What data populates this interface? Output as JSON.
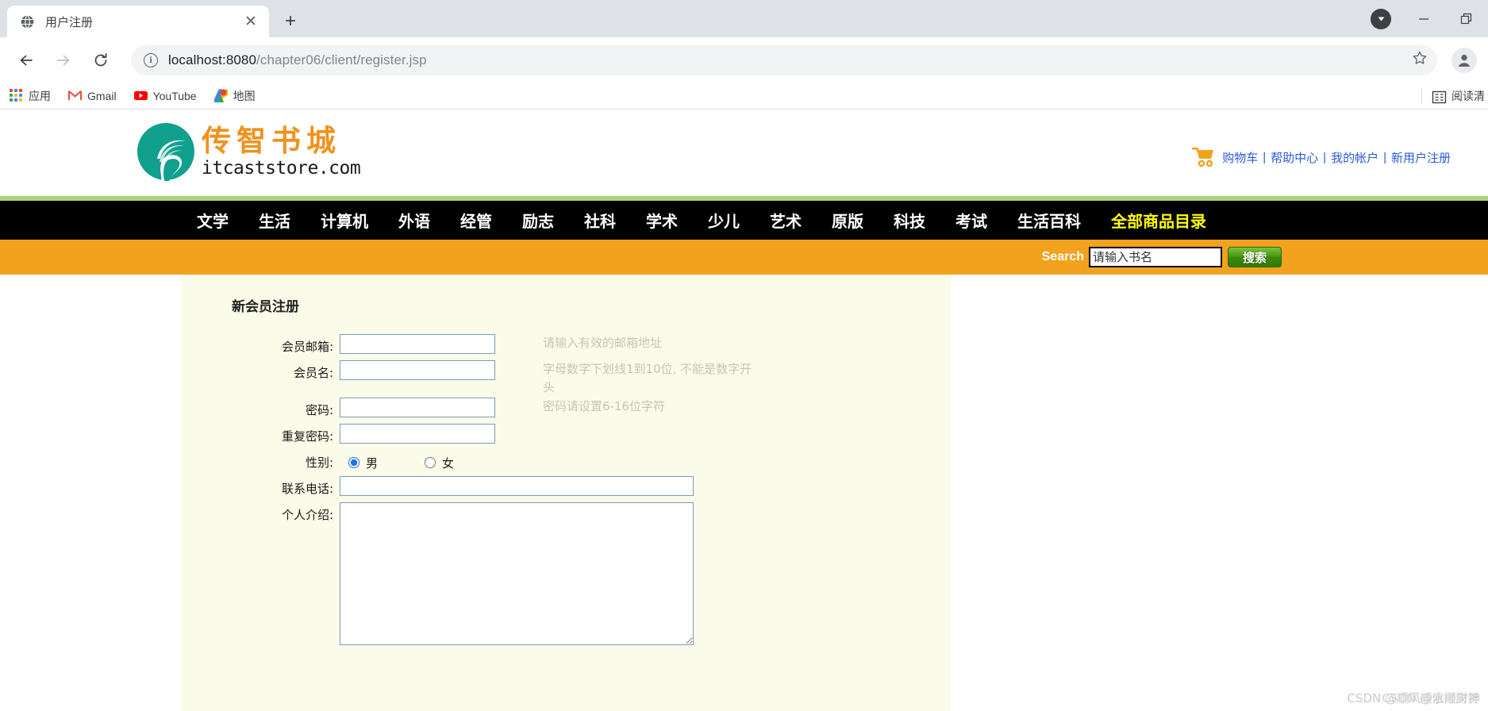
{
  "browser": {
    "tab": {
      "title": "用户注册",
      "favicon": "globe-icon",
      "close": "✕"
    },
    "new_tab": "+",
    "window_controls": {
      "download": "▼",
      "minimize": "—",
      "maximize": "❐"
    },
    "nav": {
      "back": "←",
      "forward": "→",
      "reload": "⟳"
    },
    "omnibox": {
      "info_icon": "i",
      "url_host": "localhost:8080",
      "url_path": "/chapter06/client/register.jsp",
      "url_full": "localhost:8080/chapter06/client/register.jsp",
      "star": "☆"
    },
    "profile": "person-icon",
    "bookmarks": [
      {
        "label": "应用",
        "icon": "apps-grid-icon"
      },
      {
        "label": "Gmail",
        "icon": "gmail-icon"
      },
      {
        "label": "YouTube",
        "icon": "youtube-icon"
      },
      {
        "label": "地图",
        "icon": "maps-icon"
      }
    ],
    "reading_list": "阅读清"
  },
  "site": {
    "logo": {
      "cn": "传智书城",
      "en": "itcaststore.com"
    },
    "top_links": [
      {
        "label": "购物车"
      },
      {
        "label": "帮助中心"
      },
      {
        "label": "我的帐户"
      },
      {
        "label": "新用户注册"
      }
    ],
    "top_link_sep": "|",
    "nav_items": [
      {
        "label": "文学",
        "highlight": false
      },
      {
        "label": "生活",
        "highlight": false
      },
      {
        "label": "计算机",
        "highlight": false
      },
      {
        "label": "外语",
        "highlight": false
      },
      {
        "label": "经管",
        "highlight": false
      },
      {
        "label": "励志",
        "highlight": false
      },
      {
        "label": "社科",
        "highlight": false
      },
      {
        "label": "学术",
        "highlight": false
      },
      {
        "label": "少儿",
        "highlight": false
      },
      {
        "label": "艺术",
        "highlight": false
      },
      {
        "label": "原版",
        "highlight": false
      },
      {
        "label": "科技",
        "highlight": false
      },
      {
        "label": "考试",
        "highlight": false
      },
      {
        "label": "生活百科",
        "highlight": false
      },
      {
        "label": "全部商品目录",
        "highlight": true
      }
    ],
    "search": {
      "label": "Search",
      "placeholder": "请输入书名",
      "value": "",
      "button": "搜索"
    },
    "colors": {
      "logo_orange": "#f0921e",
      "logo_teal": "#11a08e",
      "nav_bg": "#000000",
      "nav_highlight": "#ffff00",
      "green_rule": "#a8d37a",
      "search_band": "#f2a21c",
      "search_button": "#4a9a12",
      "link_blue": "#2a5bd7",
      "form_bg": "#fafbe8"
    }
  },
  "form": {
    "title": "新会员注册",
    "fields": [
      {
        "label": "会员邮箱:",
        "type": "text",
        "value": "",
        "hint": "请输入有效的邮箱地址"
      },
      {
        "label": "会员名:",
        "type": "text",
        "value": "",
        "hint": "字母数字下划线1到10位, 不能是数字开头"
      },
      {
        "label": "密码:",
        "type": "password",
        "value": "",
        "hint": "密码请设置6-16位字符"
      },
      {
        "label": "重复密码:",
        "type": "password",
        "value": "",
        "hint": ""
      }
    ],
    "gender": {
      "label": "性别:",
      "options": [
        {
          "label": "男",
          "checked": true
        },
        {
          "label": "女",
          "checked": false
        }
      ]
    },
    "phone": {
      "label": "联系电话:",
      "value": ""
    },
    "intro": {
      "label": "个人介绍:",
      "value": ""
    }
  },
  "watermark": {
    "line1": "CSDN @顺风顺水顺财神",
    "line2": "CSDN @值得庆贺"
  }
}
